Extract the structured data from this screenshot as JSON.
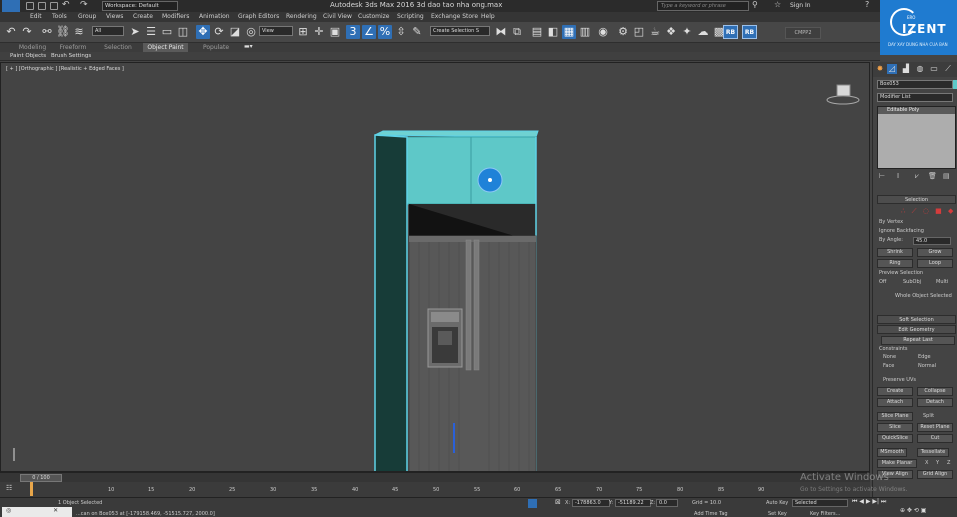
{
  "titlebar": {
    "workspace_label": "Workspace: Default",
    "title": "Autodesk 3ds Max 2016     3d dao tao nha ong.max",
    "search_placeholder": "Type a keyword or phrase",
    "sign_in": "Sign In"
  },
  "menu": {
    "items": [
      "Edit",
      "Tools",
      "Group",
      "Views",
      "Create",
      "Modifiers",
      "Animation",
      "Graph Editors",
      "Rendering",
      "Civil View",
      "Customize",
      "Scripting",
      "Exchange Store",
      "Help"
    ]
  },
  "toolbar": {
    "filter_value": "All",
    "coord_value": "View",
    "selection_set": "Create Selection S",
    "rb1": "RB",
    "rb2": "RB",
    "cmpp": "CMPP2"
  },
  "ribbon": {
    "tabs": [
      "Modeling",
      "Freeform",
      "Selection",
      "Object Paint",
      "Populate"
    ],
    "active_tab": "Object Paint",
    "sub_items": [
      "Paint Objects",
      "Brush Settings"
    ]
  },
  "viewport": {
    "label": "[ + ] [Orthographic ] [Realistic + Edged Faces ]"
  },
  "command_panel": {
    "object_name": "Box053",
    "modifier_list": "Modifier List",
    "stack_item": "Editable Poly",
    "selection_title": "Selection",
    "by_vertex": "By Vertex",
    "ignore_backfacing": "Ignore Backfacing",
    "by_angle": "By Angle:",
    "by_angle_value": "45.0",
    "shrink": "Shrink",
    "grow": "Grow",
    "ring": "Ring",
    "loop": "Loop",
    "preview_selection": "Preview Selection",
    "preview_off": "Off",
    "preview_subobj": "SubObj",
    "preview_multi": "Multi",
    "whole_object": "Whole Object Selected",
    "soft_selection": "Soft Selection",
    "edit_geometry": "Edit Geometry",
    "repeat_last": "Repeat Last",
    "constraints": "Constraints",
    "c_none": "None",
    "c_edge": "Edge",
    "c_face": "Face",
    "c_normal": "Normal",
    "preserve_uvs": "Preserve UVs",
    "create": "Create",
    "collapse": "Collapse",
    "attach": "Attach",
    "detach": "Detach",
    "slice_plane": "Slice Plane",
    "split": "Split",
    "slice": "Slice",
    "reset_plane": "Reset Plane",
    "quickslice": "QuickSlice",
    "cut": "Cut",
    "msmooth": "MSmooth",
    "tessellate": "Tessellate",
    "make_planar": "Make Planar",
    "x": "X",
    "y": "Y",
    "z": "Z",
    "view_align": "View Align",
    "grid_align": "Grid Align"
  },
  "timeline": {
    "frame": "0 / 100",
    "ticks": [
      "10",
      "15",
      "20",
      "25",
      "30",
      "35",
      "40",
      "45",
      "50",
      "55",
      "60",
      "65",
      "70",
      "75",
      "80",
      "85",
      "90"
    ]
  },
  "status": {
    "selected": "1 Object Selected",
    "prompt": "...can on Box053 at [-179158.469, -51515.727, 2000.0]",
    "x": "-178863.0",
    "y": "-51189.22",
    "z": "0.0",
    "grid": "Grid = 10.0",
    "add_time_tag": "Add Time Tag",
    "auto_key": "Auto Key",
    "auto_key_value": "Selected",
    "set_key": "Set Key",
    "key_filters": "Key Filters..."
  },
  "watermark": {
    "line1": "Activate Windows",
    "line2": "Go to Settings to activate Windows."
  },
  "logo": {
    "brand": "IZENT",
    "prefix": "ERO",
    "tagline": "DAY XAY DUNG NHA CUA BAN"
  },
  "colors": {
    "selected_face": "#5ec8c8",
    "selection_outline": "#5fd3e8",
    "accent_blue": "#2f6fb5"
  }
}
